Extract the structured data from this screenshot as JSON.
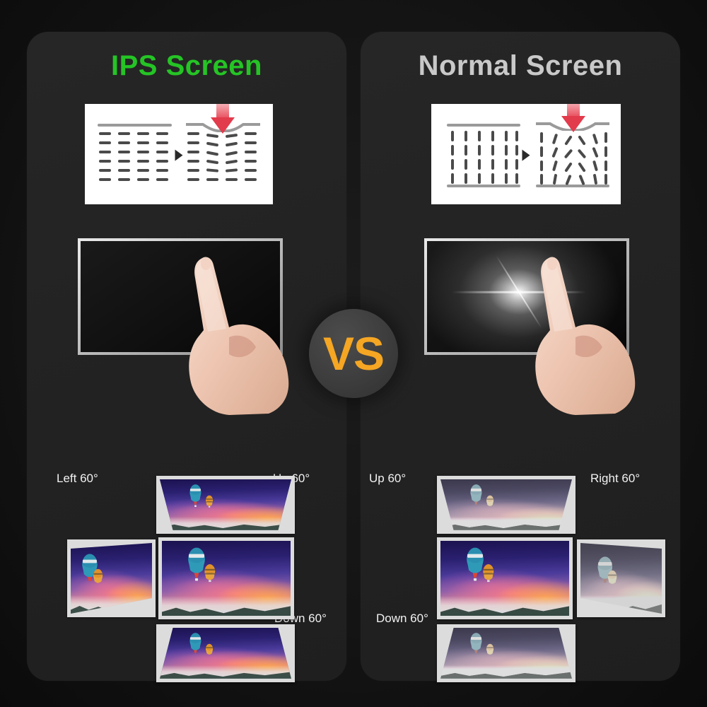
{
  "comparison": {
    "vs_label": "VS",
    "accent_orange": "#f5a623",
    "background": "#141414"
  },
  "panels": [
    {
      "id": "ips",
      "title": "IPS Screen",
      "title_color": "#25c425",
      "diagram": {
        "name": "liquid-crystal-pressure-diagram",
        "orientation": "horizontal",
        "description": "Horizontal liquid crystal alignment deforms slightly under finger pressure"
      },
      "touch_demo": {
        "name": "touch-screen-demo",
        "glow": false,
        "description": "Screen stays black when pressed"
      },
      "angles": [
        {
          "key": "left",
          "label": "Left 60°",
          "faded": false
        },
        {
          "key": "up",
          "label": "Up 60°",
          "faded": false
        },
        {
          "key": "down",
          "label": "Down 60°",
          "faded": false
        }
      ],
      "thumbnails": [
        {
          "position": "top",
          "perspective": "up",
          "faded": false
        },
        {
          "position": "left",
          "perspective": "left",
          "faded": false
        },
        {
          "position": "center",
          "perspective": "front",
          "faded": false
        },
        {
          "position": "bottom",
          "perspective": "down",
          "faded": false
        }
      ]
    },
    {
      "id": "normal",
      "title": "Normal Screen",
      "title_color": "#c9c9c9",
      "diagram": {
        "name": "liquid-crystal-pressure-diagram",
        "orientation": "vertical",
        "description": "Vertical liquid crystal alignment collapses under finger pressure"
      },
      "touch_demo": {
        "name": "touch-screen-demo",
        "glow": true,
        "description": "Bright white bloom appears where the finger presses"
      },
      "angles": [
        {
          "key": "up",
          "label": "Up 60°",
          "faded": true
        },
        {
          "key": "right",
          "label": "Right 60°",
          "faded": true
        },
        {
          "key": "down",
          "label": "Down 60°",
          "faded": true
        }
      ],
      "thumbnails": [
        {
          "position": "top",
          "perspective": "up",
          "faded": true
        },
        {
          "position": "center",
          "perspective": "front",
          "faded": false
        },
        {
          "position": "right",
          "perspective": "right",
          "faded": true
        },
        {
          "position": "bottom",
          "perspective": "down",
          "faded": true
        }
      ]
    }
  ],
  "photo": {
    "subject": "hot-air-balloons-at-sunset",
    "colors": {
      "sky_top": "#1b1250",
      "sky_mid": "#8a5fa8",
      "sky_low": "#f0b38a",
      "balloon_main": "#2a8fb0",
      "balloon_small": "#e0922a",
      "mountains": "#2b3a33"
    }
  }
}
